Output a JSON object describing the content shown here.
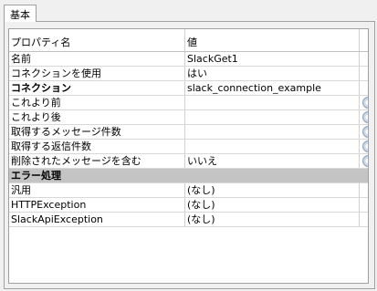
{
  "tab": {
    "label": "基本"
  },
  "header": {
    "property": "プロパティ名",
    "value": "値"
  },
  "rows": [
    {
      "name": "名前",
      "value": "SlackGet1"
    },
    {
      "name": "コネクションを使用",
      "value": "はい"
    },
    {
      "name": "コネクション",
      "value": "slack_connection_example"
    },
    {
      "name": "これより前",
      "value": ""
    },
    {
      "name": "これより後",
      "value": ""
    },
    {
      "name": "取得するメッセージ件数",
      "value": ""
    },
    {
      "name": "取得する返信件数",
      "value": ""
    },
    {
      "name": "削除されたメッセージを含む",
      "value": "いいえ"
    }
  ],
  "section": {
    "label": "エラー処理"
  },
  "error_rows": [
    {
      "name": "汎用",
      "value": "(なし)"
    },
    {
      "name": "HTTPException",
      "value": "(なし)"
    },
    {
      "name": "SlackApiException",
      "value": "(なし)"
    }
  ],
  "icons": {
    "row_button": "ellipsis-circle-icon"
  },
  "colors": {
    "section_bg": "#c4c4c4",
    "grid_line": "#d8d8d8"
  }
}
